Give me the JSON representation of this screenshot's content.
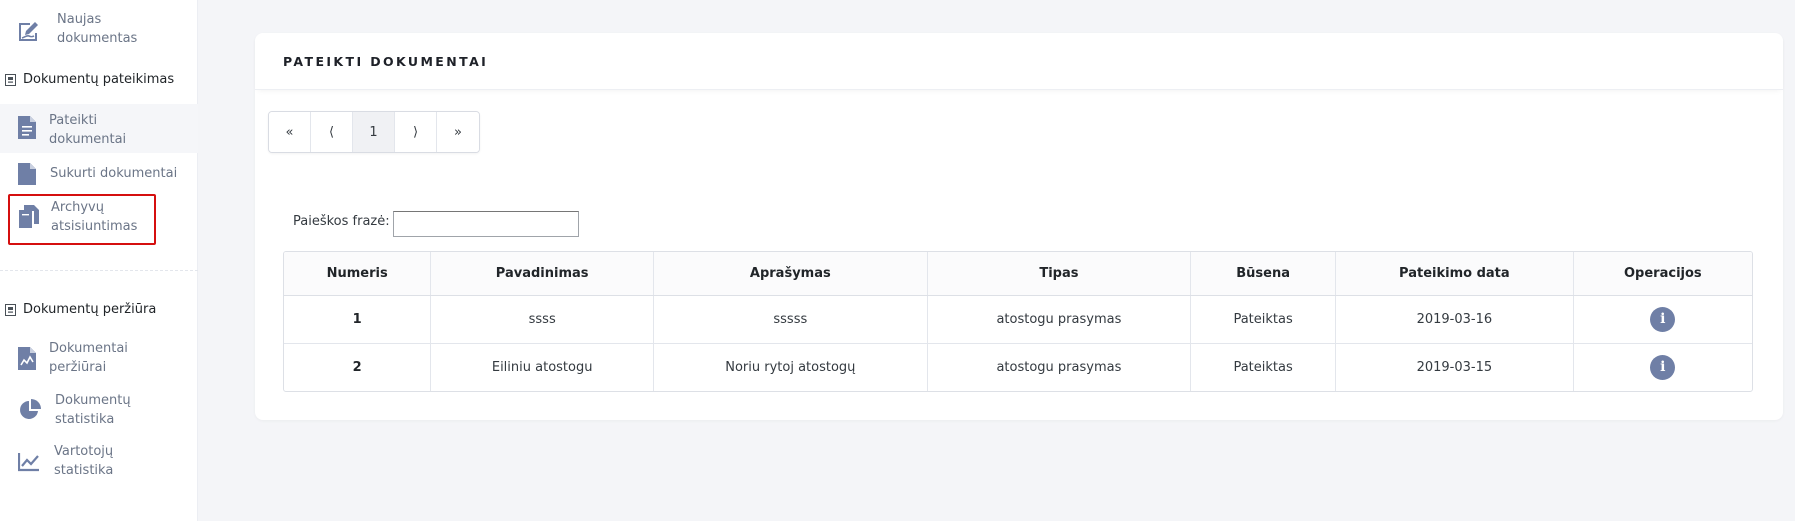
{
  "sidebar": {
    "new_document": {
      "label": "Naujas dokumentas",
      "line1": "Naujas",
      "line2": "dokumentas",
      "icon": "edit-document-icon"
    },
    "section_submission": {
      "title": "Dokumentų pateikimas",
      "icon": "section-doc-icon"
    },
    "submitted_documents": {
      "line1": "Pateikti",
      "line2": "dokumentai",
      "icon": "document-lines-icon",
      "active": true
    },
    "created_documents": {
      "label": "Sukurti dokumentai",
      "icon": "document-icon"
    },
    "archive_download": {
      "line1": "Archyvų",
      "line2": "atsisiuntimas",
      "icon": "copy-documents-icon",
      "highlighted": true
    },
    "section_review": {
      "title": "Dokumentų peržiūra",
      "icon": "section-doc-icon"
    },
    "documents_review": {
      "line1": "Dokumentai",
      "line2": "peržiūrai",
      "icon": "document-chart-icon"
    },
    "documents_statistics": {
      "line1": "Dokumentų",
      "line2": "statistika",
      "icon": "pie-chart-icon"
    },
    "users_statistics": {
      "line1": "Vartotojų",
      "line2": "statistika",
      "icon": "line-chart-icon"
    }
  },
  "main": {
    "title": "PATEIKTI DOKUMENTAI",
    "pagination": {
      "first": "«",
      "prev": "⟨",
      "page": "1",
      "next": "⟩",
      "last": "»"
    },
    "search": {
      "label": "Paieškos frazė:",
      "value": ""
    },
    "table": {
      "headers": [
        "Numeris",
        "Pavadinimas",
        "Aprašymas",
        "Tipas",
        "Būsena",
        "Pateikimo data",
        "Operacijos"
      ],
      "rows": [
        {
          "number": "1",
          "name": "ssss",
          "description": "sssss",
          "type": "atostogu prasymas",
          "status": "Pateiktas",
          "date": "2019-03-16",
          "action_icon": "info-icon"
        },
        {
          "number": "2",
          "name": "Eiliniu atostogu",
          "description": "Noriu rytoj atostogų",
          "type": "atostogu prasymas",
          "status": "Pateiktas",
          "date": "2019-03-15",
          "action_icon": "info-icon"
        }
      ]
    }
  },
  "colors": {
    "icon": "#6f7fa6",
    "highlight_border": "#d50f0f",
    "background": "#f4f5f8"
  }
}
